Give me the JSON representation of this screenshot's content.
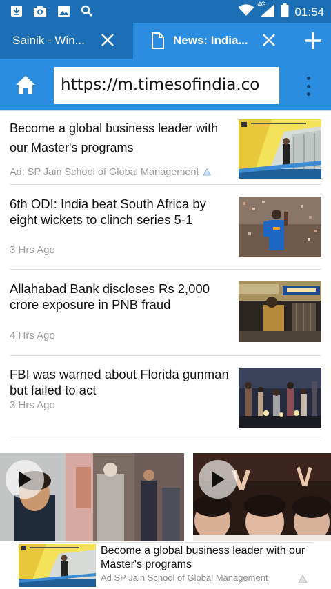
{
  "status_bar": {
    "time": "01:54",
    "network": "4G"
  },
  "tabs": [
    {
      "label": "Sainik - Win...",
      "active": false
    },
    {
      "label": "News: India...",
      "active": true
    }
  ],
  "address_bar": {
    "url": "https://m.timesofindia.co"
  },
  "feed": {
    "items": [
      {
        "headline": "Become a global business leader with our Master's programs",
        "meta": "Ad: SP Jain School of Global Management",
        "is_ad": true
      },
      {
        "headline": "6th ODI: India beat South Africa by eight wickets to clinch series 5-1",
        "meta": "3 Hrs Ago",
        "is_ad": false
      },
      {
        "headline": "Allahabad Bank discloses Rs 2,000 crore exposure in PNB fraud",
        "meta": "4 Hrs Ago",
        "is_ad": false
      },
      {
        "headline": "FBI was warned about Florida gunman but failed to act",
        "meta": "3 Hrs Ago",
        "is_ad": false
      }
    ]
  },
  "banner_ad": {
    "text": "Become a global business leader with our Master's programs",
    "meta": "Ad SP Jain School of Global Management"
  },
  "colors": {
    "status_bar": "#1d6fb5",
    "tab_active": "#2b8de0",
    "toolbar": "#2b8de0"
  }
}
